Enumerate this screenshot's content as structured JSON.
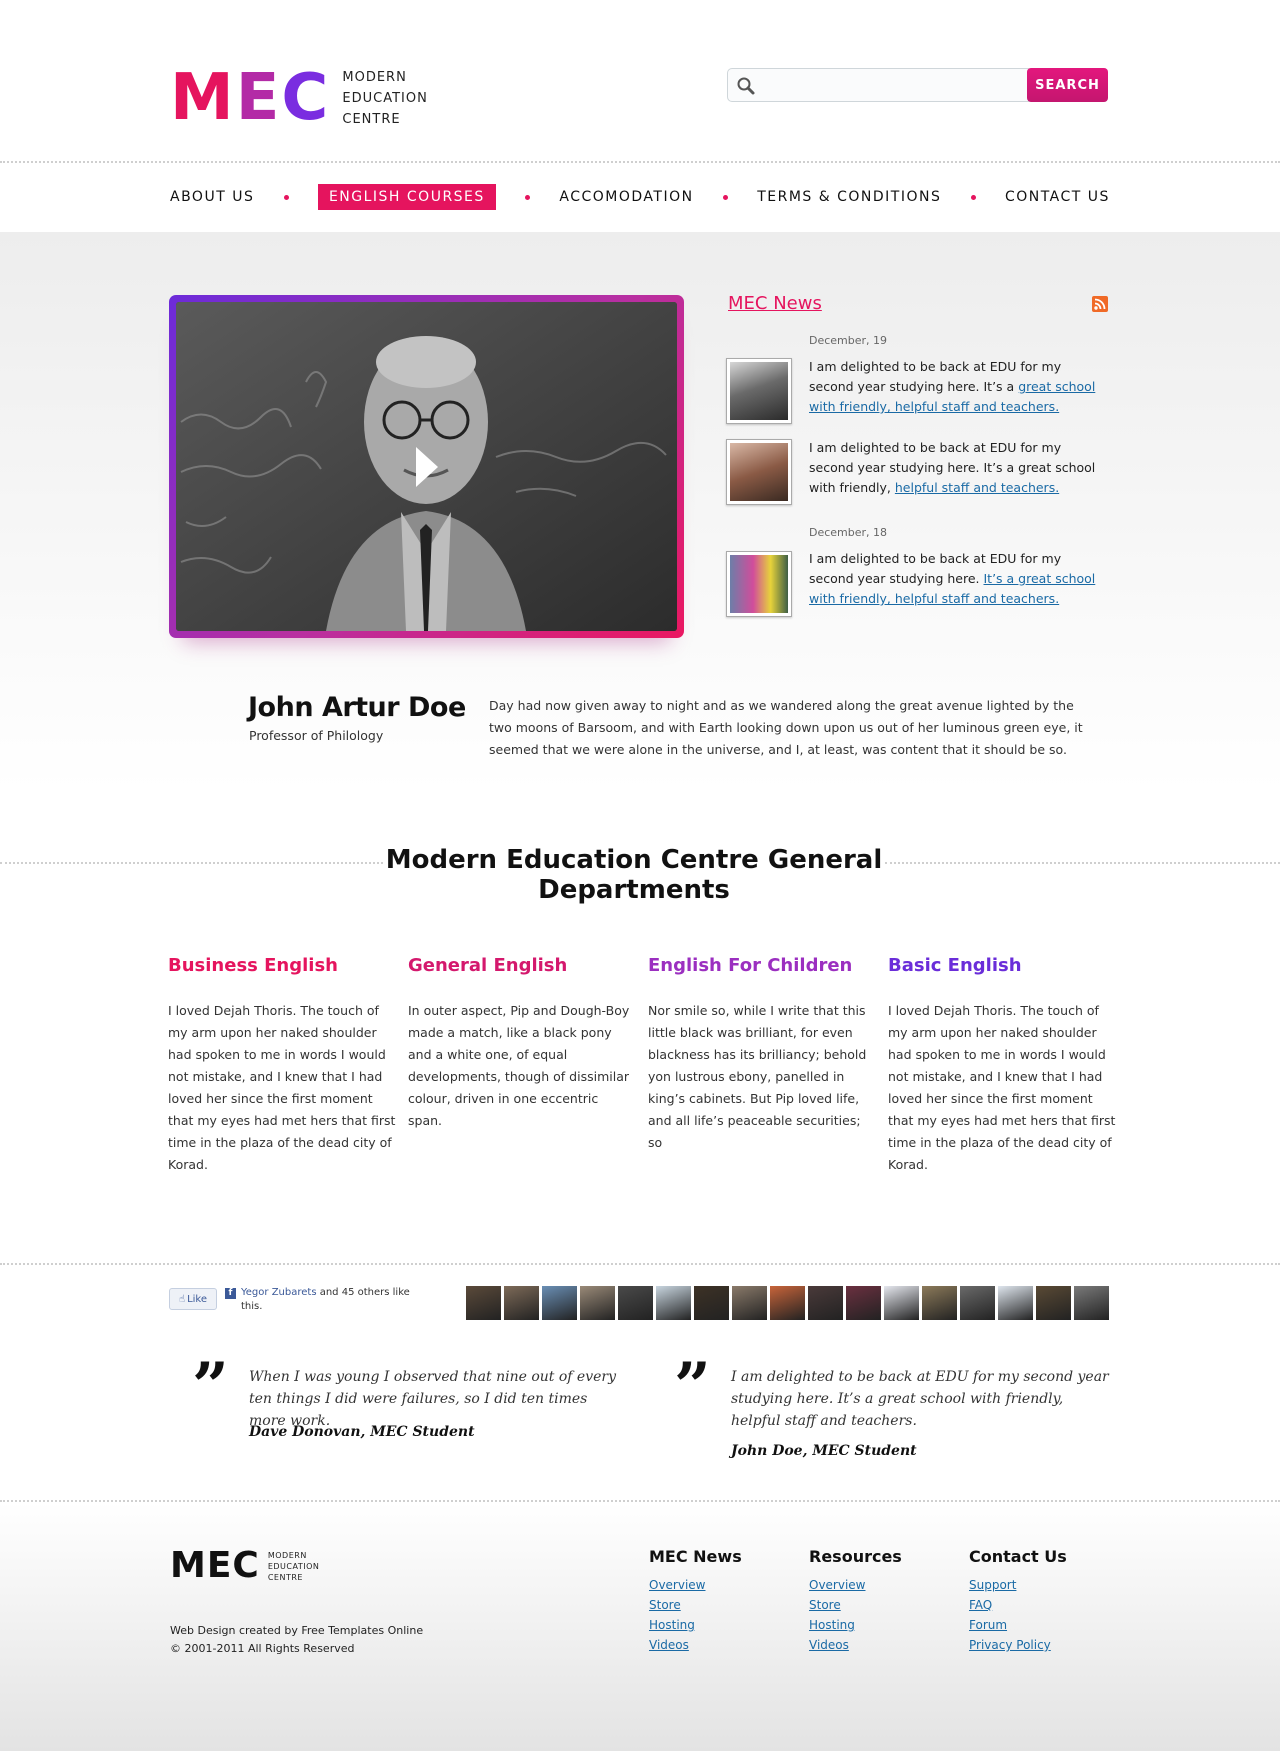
{
  "header": {
    "logo_mark": [
      "M",
      "E",
      "C"
    ],
    "logo_text": [
      "MODERN",
      "EDUCATION",
      "CENTRE"
    ],
    "search_placeholder": "",
    "search_button": "SEARCH"
  },
  "nav": {
    "items": [
      "ABOUT US",
      "ENGLISH COURSES",
      "ACCOMODATION",
      "TERMS & CONDITIONS",
      "CONTACT US"
    ],
    "active_index": 1
  },
  "news": {
    "title": "MEC News",
    "groups": [
      {
        "date": "December, 19",
        "items": [
          {
            "text": "I am delighted to be back at EDU for my second year studying here. It’s a ",
            "link": "great school with friendly, helpful staff and teachers. "
          },
          {
            "text": "I am delighted to be back at EDU for my second year studying here. It’s a great school with friendly, ",
            "link": "helpful staff and teachers. "
          }
        ]
      },
      {
        "date": "December, 18",
        "items": [
          {
            "text": "I am delighted to be back at EDU for my second year studying here. ",
            "link": "It’s a great school with friendly, helpful staff and teachers. "
          }
        ]
      }
    ]
  },
  "featured": {
    "name": "John Artur Doe",
    "role": "Professor of Philology",
    "quote": "Day had now given away to night and as we wandered along the great avenue lighted by the two moons of Barsoom, and with Earth looking down upon us out of her luminous green eye, it seemed that we were alone in the universe, and I, at least, was content that it should be so."
  },
  "departments": {
    "heading": "Modern Education Centre General Departments",
    "items": [
      {
        "title": "Business English",
        "color": "#e5145e",
        "text": "I loved Dejah Thoris. The touch of my arm upon her naked shoulder had spoken to me in words I would not mistake, and I knew that I had loved her since the first moment that my eyes had met hers that first time in the plaza of the dead city of Korad."
      },
      {
        "title": "General English",
        "color": "#d4186d",
        "text": "In outer aspect, Pip and Dough-Boy made a match, like a black pony and a white one, of equal developments, though of dissimilar colour, driven in one eccentric span."
      },
      {
        "title": "English For Children",
        "color": "#9b2fc0",
        "text": "Nor smile so, while I write that this little black was brilliant, for even blackness has its brilliancy; behold yon lustrous ebony, panelled in king’s cabinets. But Pip loved life, and all life’s peaceable securities; so"
      },
      {
        "title": "Basic English",
        "color": "#6a2dd9",
        "text": "I loved Dejah Thoris. The touch of my arm upon her naked shoulder had spoken to me in words I would not mistake, and I knew that I had loved her since the first moment that my eyes had met hers that first time in the plaza of the dead city of Korad."
      }
    ]
  },
  "facebook": {
    "like_label": "Like",
    "icon_letter": "f",
    "liker_name": "Yegor Zubarets",
    "liker_rest": " and 45 others like this.",
    "faces": 17
  },
  "testimonials": [
    {
      "quote": "When I was young I observed that nine out of every ten things I did were failures, so I did ten times more work.",
      "author": "Dave Donovan, MEC Student"
    },
    {
      "quote": "I am delighted to be back at EDU for my second year studying here. It’s a great school with friendly, helpful staff and teachers.",
      "author": "John Doe, MEC Student"
    }
  ],
  "footer": {
    "logo_mark": "MEC",
    "logo_text": [
      "MODERN",
      "EDUCATION",
      "CENTRE"
    ],
    "credit": "Web Design created by Free Templates Online",
    "copyright": "© 2001-2011 All Rights Reserved",
    "columns": [
      {
        "title": "MEC News",
        "links": [
          "Overview",
          "Store",
          "Hosting",
          "Videos"
        ]
      },
      {
        "title": "Resources",
        "links": [
          "Overview",
          "Store",
          "Hosting",
          "Videos"
        ]
      },
      {
        "title": "Contact Us",
        "links": [
          "Support",
          "FAQ",
          "Forum",
          "Privacy Policy"
        ]
      }
    ]
  },
  "colors": {
    "accent": "#e5145e",
    "purple": "#7a2de0",
    "link": "#1a6aa5"
  }
}
